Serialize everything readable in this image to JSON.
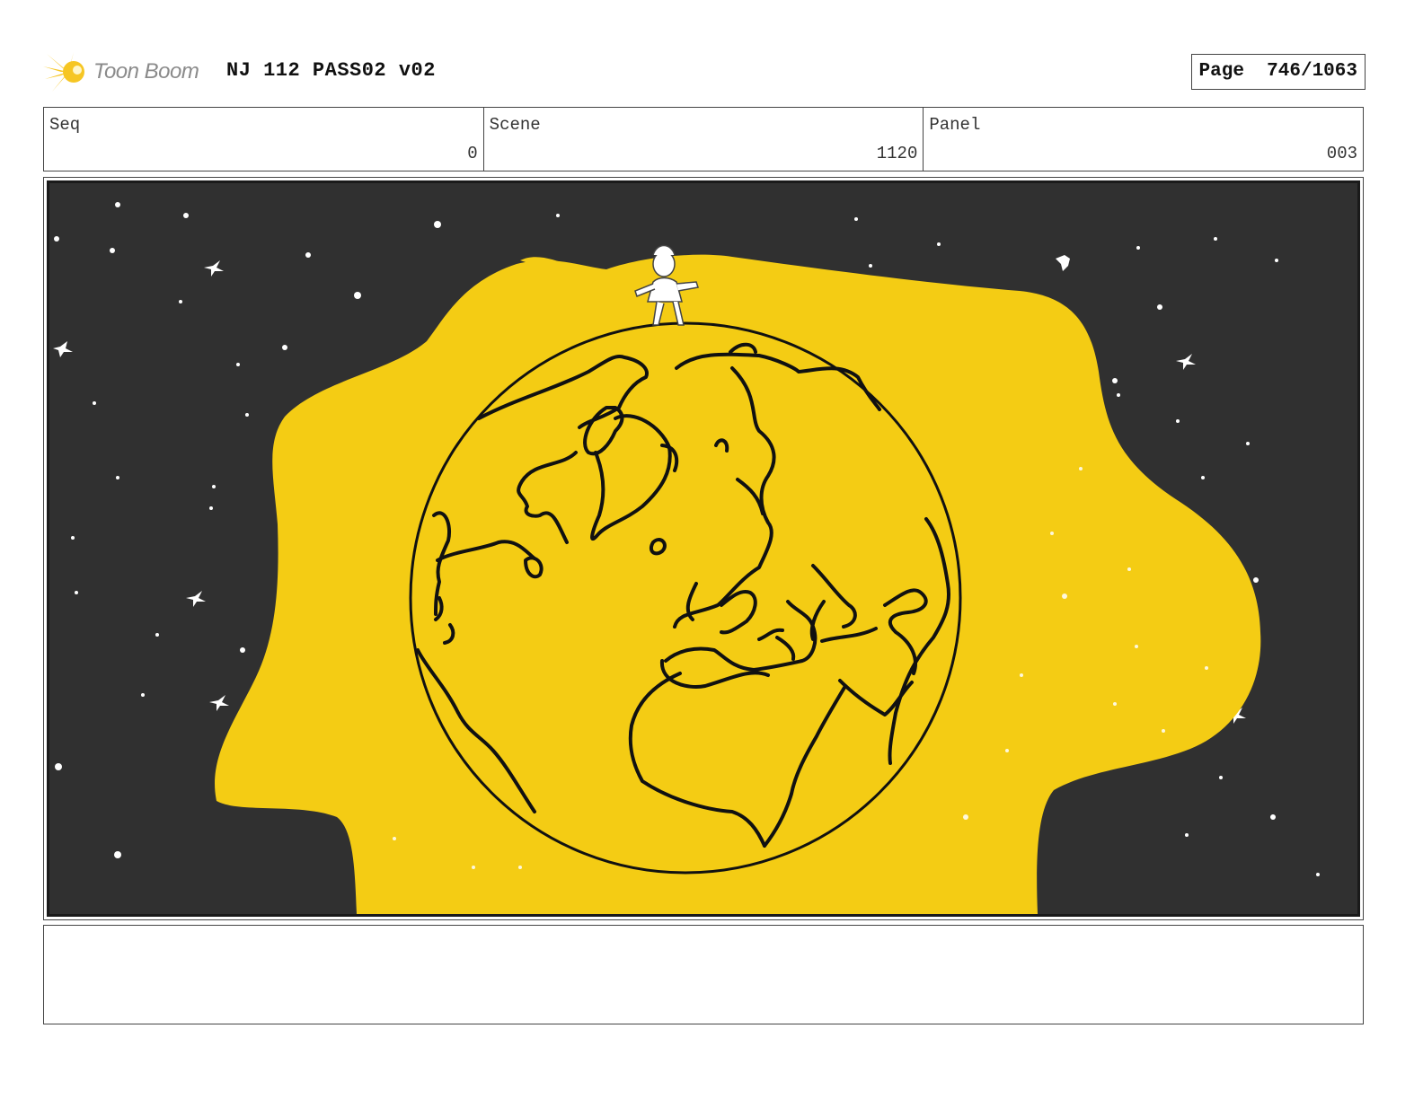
{
  "header": {
    "logo_text": "Toon Boom",
    "title": "NJ 112 PASS02 v02",
    "page_label": "Page",
    "page_value": "746/1063"
  },
  "info": {
    "seq_label": "Seq",
    "seq_value": "0",
    "scene_label": "Scene",
    "scene_value": "1120",
    "panel_label": "Panel",
    "panel_value": "003"
  },
  "colors": {
    "space": "#303030",
    "glow": "#f4cc14",
    "line": "#111111",
    "star": "#ffffff",
    "logo_flare": "#f6c623"
  },
  "icons": {
    "logo": "toon-boom-flare-icon"
  },
  "notes": {
    "text": ""
  }
}
